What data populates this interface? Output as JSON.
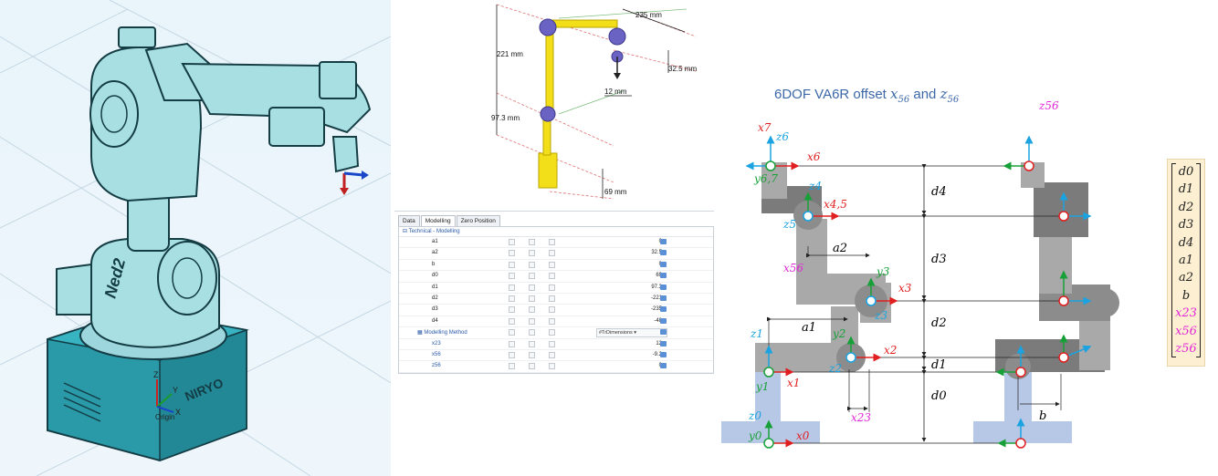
{
  "sim": {
    "dimensions": {
      "d_top": "235 mm",
      "d_height": "221 mm",
      "d_small": "32.5 mm",
      "d_mid": "97.3 mm",
      "d_offset": "12 mm",
      "d_base": "69 mm"
    },
    "tabs": [
      "Data",
      "Modelling",
      "Zero Position"
    ],
    "active_tab": "Modelling",
    "section": "Technical - Modelling",
    "rows": [
      {
        "name": "a1",
        "value": "0"
      },
      {
        "name": "a2",
        "value": "32.5"
      },
      {
        "name": "b",
        "value": "0"
      },
      {
        "name": "d0",
        "value": "69"
      },
      {
        "name": "d1",
        "value": "97.3"
      },
      {
        "name": "d2",
        "value": "-221"
      },
      {
        "name": "d3",
        "value": "-235"
      },
      {
        "name": "d4",
        "value": "-48"
      }
    ],
    "method_row": {
      "name": "Modelling Method",
      "value": "#TrDimensions"
    },
    "offset_rows": [
      {
        "name": "x23",
        "value": "12"
      },
      {
        "name": "x56",
        "value": "-9.2"
      },
      {
        "name": "z56",
        "value": "0"
      }
    ]
  },
  "viewport": {
    "brand": "Ned2",
    "base_label": "NIRYO",
    "axes": {
      "z": "Z",
      "y": "Y",
      "x": "X",
      "origin": "Origin"
    }
  },
  "diagram": {
    "title_prefix": "6DOF VA6R offset",
    "title_var1": "x",
    "title_sub1": "56",
    "title_and": "and",
    "title_var2": "z",
    "title_sub2": "56",
    "dims": {
      "d4": "d4",
      "d3": "d3",
      "d2": "d2",
      "d1": "d1",
      "d0": "d0",
      "a1": "a1",
      "a2": "a2",
      "b": "b"
    },
    "frame_labels": [
      "x7",
      "z6",
      "x6",
      "y6,7",
      "x4,5",
      "z4",
      "z5",
      "x3",
      "y3",
      "z3",
      "z2",
      "y2",
      "x2",
      "z1",
      "y1",
      "x1",
      "z0",
      "y0",
      "x0",
      "x56",
      "x23",
      "z56"
    ],
    "legend": {
      "black": [
        "d0",
        "d1",
        "d2",
        "d3",
        "d4",
        "a1",
        "a2",
        "b"
      ],
      "pink": [
        "x23",
        "x56",
        "z56"
      ]
    },
    "colors": {
      "x_axis": "#e02020",
      "y_axis": "#18a038",
      "z_axis": "#1aa3e0",
      "pink": "#e026d6",
      "link": "#a9a9a9",
      "link_dark": "#7b7b7b",
      "base": "#b7c7e6"
    }
  }
}
